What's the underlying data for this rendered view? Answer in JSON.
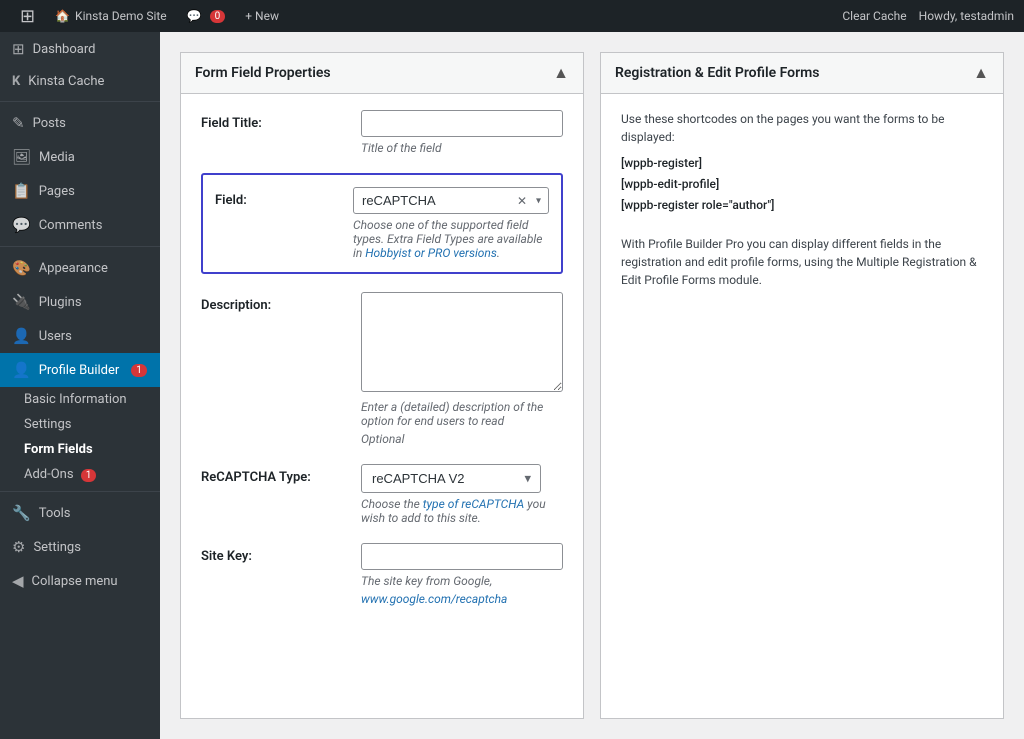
{
  "adminBar": {
    "wpLogoLabel": "W",
    "siteName": "Kinsta Demo Site",
    "commentIcon": "💬",
    "commentCount": "0",
    "newLabel": "+ New",
    "clearCache": "Clear Cache",
    "howdy": "Howdy, testadmin"
  },
  "sidebar": {
    "items": [
      {
        "id": "dashboard",
        "label": "Dashboard",
        "icon": "⊞"
      },
      {
        "id": "kinsta-cache",
        "label": "Kinsta Cache",
        "icon": "K"
      },
      {
        "id": "posts",
        "label": "Posts",
        "icon": "📄"
      },
      {
        "id": "media",
        "label": "Media",
        "icon": "🖼"
      },
      {
        "id": "pages",
        "label": "Pages",
        "icon": "📋"
      },
      {
        "id": "comments",
        "label": "Comments",
        "icon": "💬"
      },
      {
        "id": "appearance",
        "label": "Appearance",
        "icon": "🎨"
      },
      {
        "id": "plugins",
        "label": "Plugins",
        "icon": "🔌"
      },
      {
        "id": "users",
        "label": "Users",
        "icon": "👤"
      },
      {
        "id": "profile-builder",
        "label": "Profile Builder",
        "badge": "1",
        "icon": "👤"
      }
    ],
    "subItems": [
      {
        "id": "basic-information",
        "label": "Basic Information"
      },
      {
        "id": "settings",
        "label": "Settings"
      },
      {
        "id": "form-fields",
        "label": "Form Fields",
        "active": true
      },
      {
        "id": "add-ons",
        "label": "Add-Ons",
        "badge": "1"
      }
    ],
    "bottomItems": [
      {
        "id": "tools",
        "label": "Tools",
        "icon": "🔧"
      },
      {
        "id": "settings",
        "label": "Settings",
        "icon": "⚙"
      },
      {
        "id": "collapse",
        "label": "Collapse menu",
        "icon": "◀"
      }
    ]
  },
  "formPanel": {
    "title": "Form Field Properties",
    "fieldTitleLabel": "Field Title:",
    "fieldTitlePlaceholder": "",
    "fieldTitleHint": "Title of the field",
    "fieldLabel": "Field:",
    "fieldValue": "reCAPTCHA",
    "fieldHint": "Choose one of the supported field types. Extra Field Types are available in",
    "fieldHintLink": "Hobbyist or PRO versions",
    "descriptionLabel": "Description:",
    "descriptionHint1": "Enter a (detailed) description of the option for end users to read",
    "descriptionHint2": "Optional",
    "recaptchaTypeLabel": "ReCAPTCHA Type:",
    "recaptchaTypeValue": "reCAPTCHA V2",
    "recaptchaTypeHint1": "Choose the",
    "recaptchaTypeHintLink": "type of reCAPTCHA",
    "recaptchaTypeHint2": "you wish to add to this site.",
    "siteKeyLabel": "Site Key:",
    "siteKeyPlaceholder": "",
    "siteKeyHint1": "The site key from Google,",
    "siteKeyHintLink": "www.google.com/recaptcha"
  },
  "sidebarPanel": {
    "title": "Registration & Edit Profile Forms",
    "description": "Use these shortcodes on the pages you want the forms to be displayed:",
    "shortcodes": [
      "[wppb-register]",
      "[wppb-edit-profile]",
      "[wppb-register role=\"author\"]"
    ],
    "note": "With Profile Builder Pro you can display different fields in the registration and edit profile forms, using the Multiple Registration & Edit Profile Forms module."
  }
}
